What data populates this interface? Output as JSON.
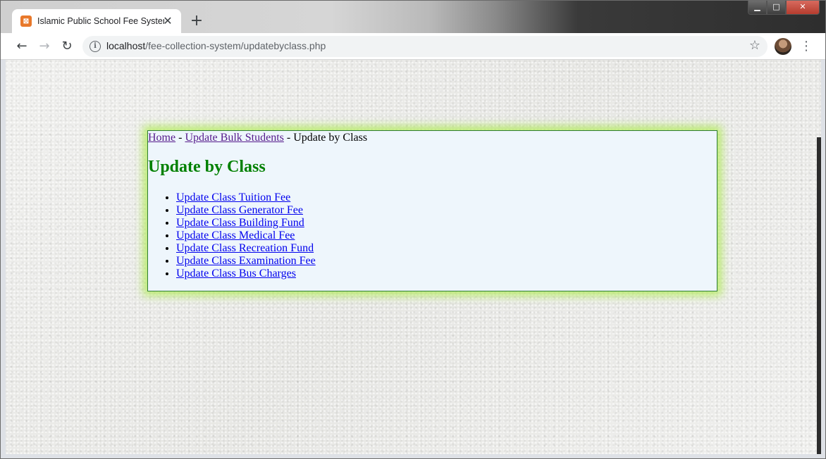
{
  "browser": {
    "tab": {
      "title": "Islamic Public School Fee System",
      "favicon_glyph": "⊠",
      "close_glyph": "✕"
    },
    "new_tab_glyph": "+",
    "window_controls": {
      "minimize": "▁",
      "maximize": "□",
      "close": "✕"
    },
    "nav": {
      "back": "←",
      "forward": "→",
      "reload": "↻"
    },
    "address": {
      "host": "localhost",
      "path": "/fee-collection-system/updatebyclass.php",
      "info_glyph": "i"
    },
    "star_glyph": "☆",
    "menu_glyph": "⋮"
  },
  "page": {
    "breadcrumb": {
      "home": "Home",
      "sep1": " - ",
      "bulk": "Update Bulk Students",
      "sep2": " - ",
      "current": "Update by Class"
    },
    "title": "Update by Class",
    "links": [
      "Update Class Tuition Fee",
      "Update Class Generator Fee",
      "Update Class Building Fund",
      "Update Class Medical Fee",
      "Update Class Recreation Fund",
      "Update Class Examination Fee",
      "Update Class Bus Charges"
    ]
  },
  "colors": {
    "title_green": "#008000",
    "panel_bg": "#eef6fc",
    "glow": "#aaeb46",
    "link": "#0000ee",
    "visited_link": "#551a8b"
  }
}
